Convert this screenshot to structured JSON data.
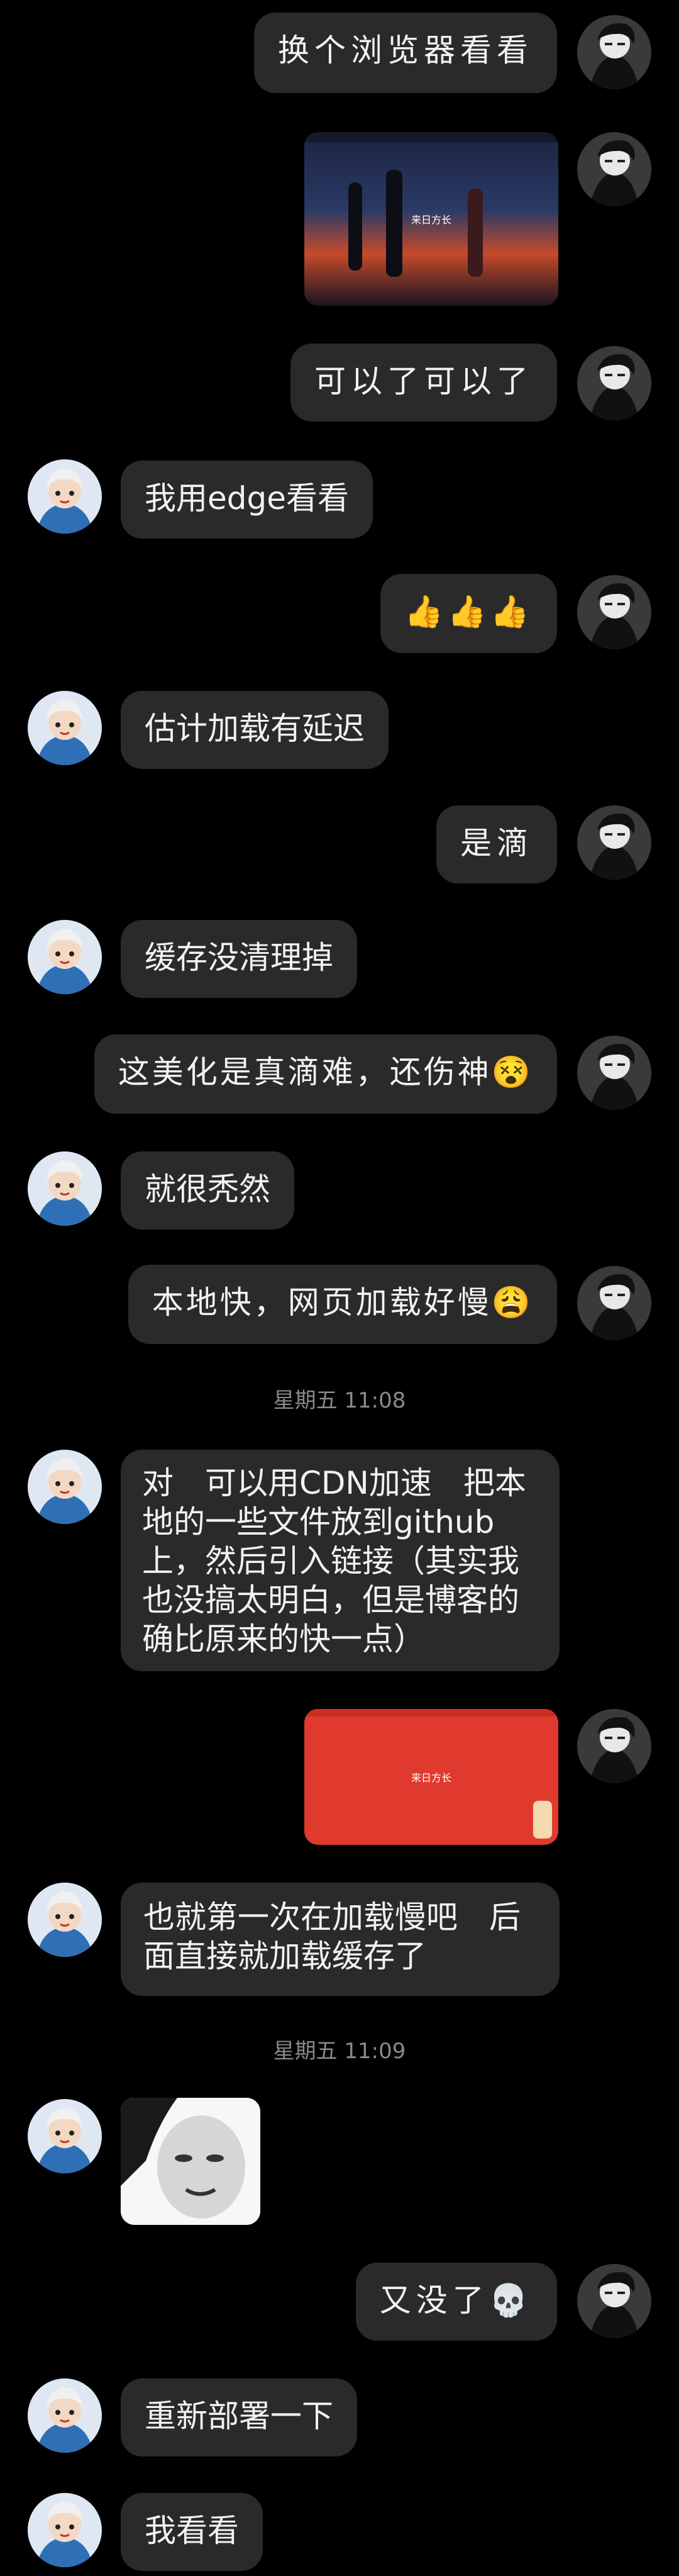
{
  "messages": [
    {
      "id": "m1",
      "sender": "me",
      "text": "换个浏览器看看"
    },
    {
      "id": "m2",
      "sender": "me",
      "image": "anime-wallpaper-screenshot",
      "caption": "来日方长"
    },
    {
      "id": "m3",
      "sender": "me",
      "text": "可以了可以了"
    },
    {
      "id": "m4",
      "sender": "other",
      "text": "我用edge看看"
    },
    {
      "id": "m5",
      "sender": "me",
      "text": "👍👍👍"
    },
    {
      "id": "m6",
      "sender": "other",
      "text": "估计加载有延迟"
    },
    {
      "id": "m7",
      "sender": "me",
      "text": "是滴"
    },
    {
      "id": "m8",
      "sender": "other",
      "text": "缓存没清理掉"
    },
    {
      "id": "m9",
      "sender": "me",
      "text": "这美化是真滴难，还伤神😵"
    },
    {
      "id": "m10",
      "sender": "other",
      "text": "就很秃然"
    },
    {
      "id": "m11",
      "sender": "me",
      "text": "本地快，网页加载好慢😩"
    },
    {
      "id": "m12",
      "sender": "other",
      "text": "对　可以用CDN加速　把本地的一些文件放到github上，然后引入链接（其实我也没搞太明白，但是博客的确比原来的快一点）"
    },
    {
      "id": "m13",
      "sender": "me",
      "image": "red-blog-screenshot",
      "caption": "来日方长"
    },
    {
      "id": "m14",
      "sender": "other",
      "text": "也就第一次在加载慢吧　后面直接就加载缓存了"
    },
    {
      "id": "m15",
      "sender": "other",
      "image": "meme-sticker"
    },
    {
      "id": "m16",
      "sender": "me",
      "text": "又没了💀"
    },
    {
      "id": "m17",
      "sender": "other",
      "text": "重新部署一下"
    },
    {
      "id": "m18",
      "sender": "other",
      "text": "我看看"
    }
  ],
  "timestamps": {
    "t1": "星期五 11:08",
    "t2": "星期五 11:09"
  },
  "colors": {
    "background": "#000000",
    "bubble": "#2a2a2a",
    "timestamp": "#8a8a8a",
    "red_screenshot": "#e03a2e"
  }
}
